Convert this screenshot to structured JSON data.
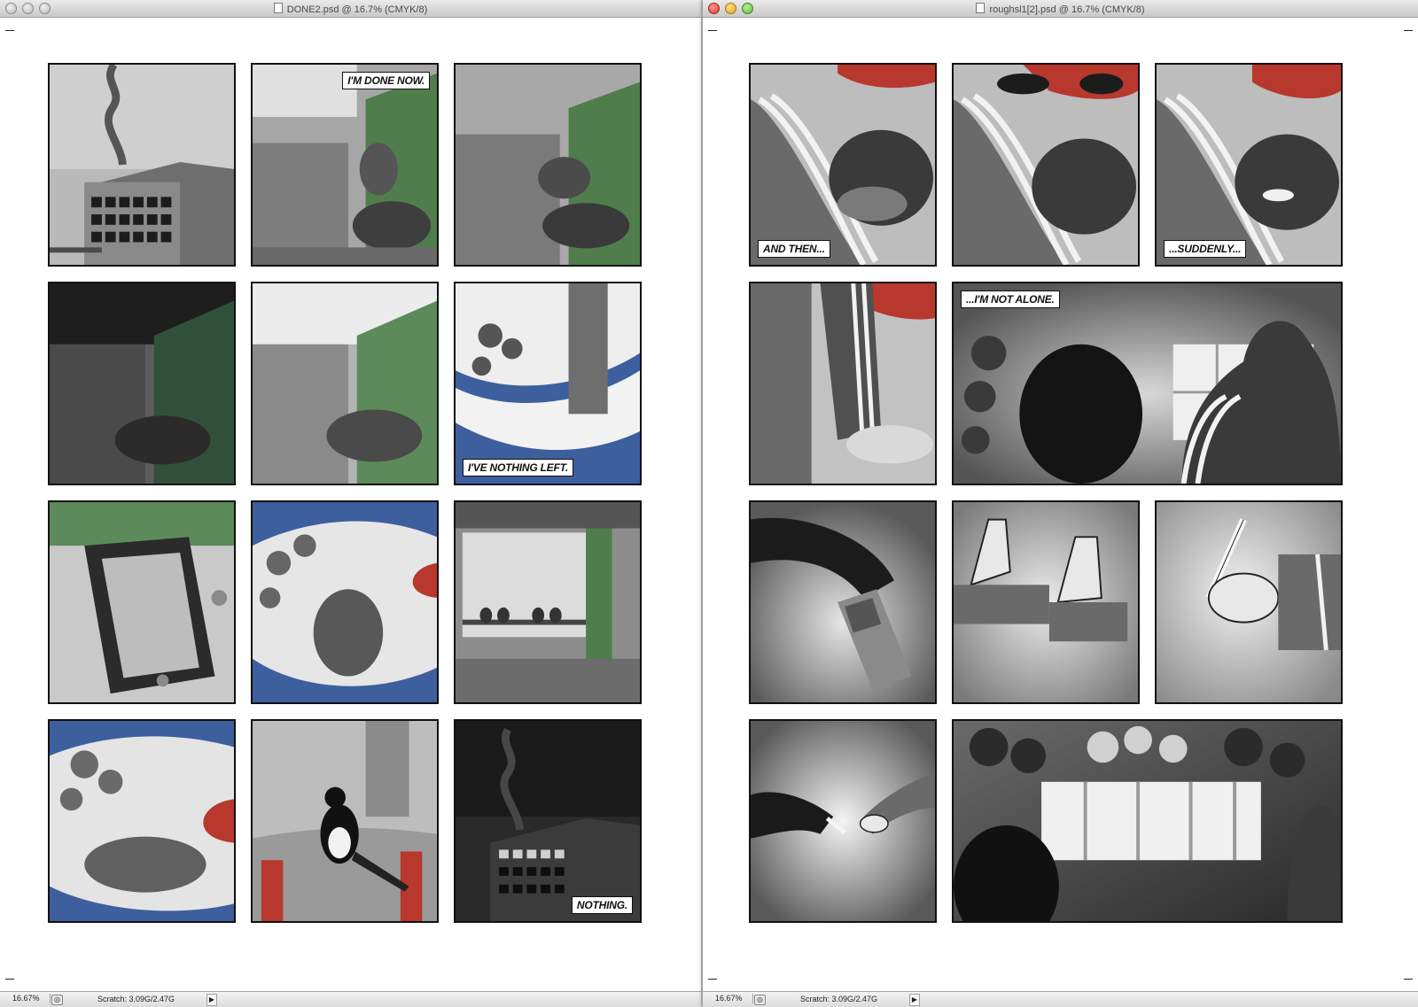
{
  "windows": [
    {
      "title": "DONE2.psd @ 16.7% (CMYK/8)",
      "active": false,
      "zoom": "16.67%",
      "scratch": "Scratch: 3.09G/2.47G",
      "captions": {
        "done_now": "I'M DONE NOW.",
        "nothing_left": "I'VE NOTHING LEFT.",
        "nothing": "NOTHING."
      }
    },
    {
      "title": "roughsl1[2].psd @ 16.7% (CMYK/8)",
      "active": true,
      "zoom": "16.67%",
      "scratch": "Scratch: 3.09G/2.47G",
      "captions": {
        "and_then": "AND THEN...",
        "suddenly": "...SUDDENLY...",
        "not_alone": "...I'M NOT ALONE."
      }
    }
  ],
  "icons": {
    "window_controls": [
      "close-button",
      "minimize-button",
      "zoom-button"
    ],
    "document": "document-icon",
    "status_toggle": "status-menu-icon",
    "status_arrow": "play-arrow-icon"
  },
  "colors": {
    "accent_red": "#b8382e",
    "accent_blue": "#3d5f9e",
    "accent_green": "#4f7d4c"
  }
}
